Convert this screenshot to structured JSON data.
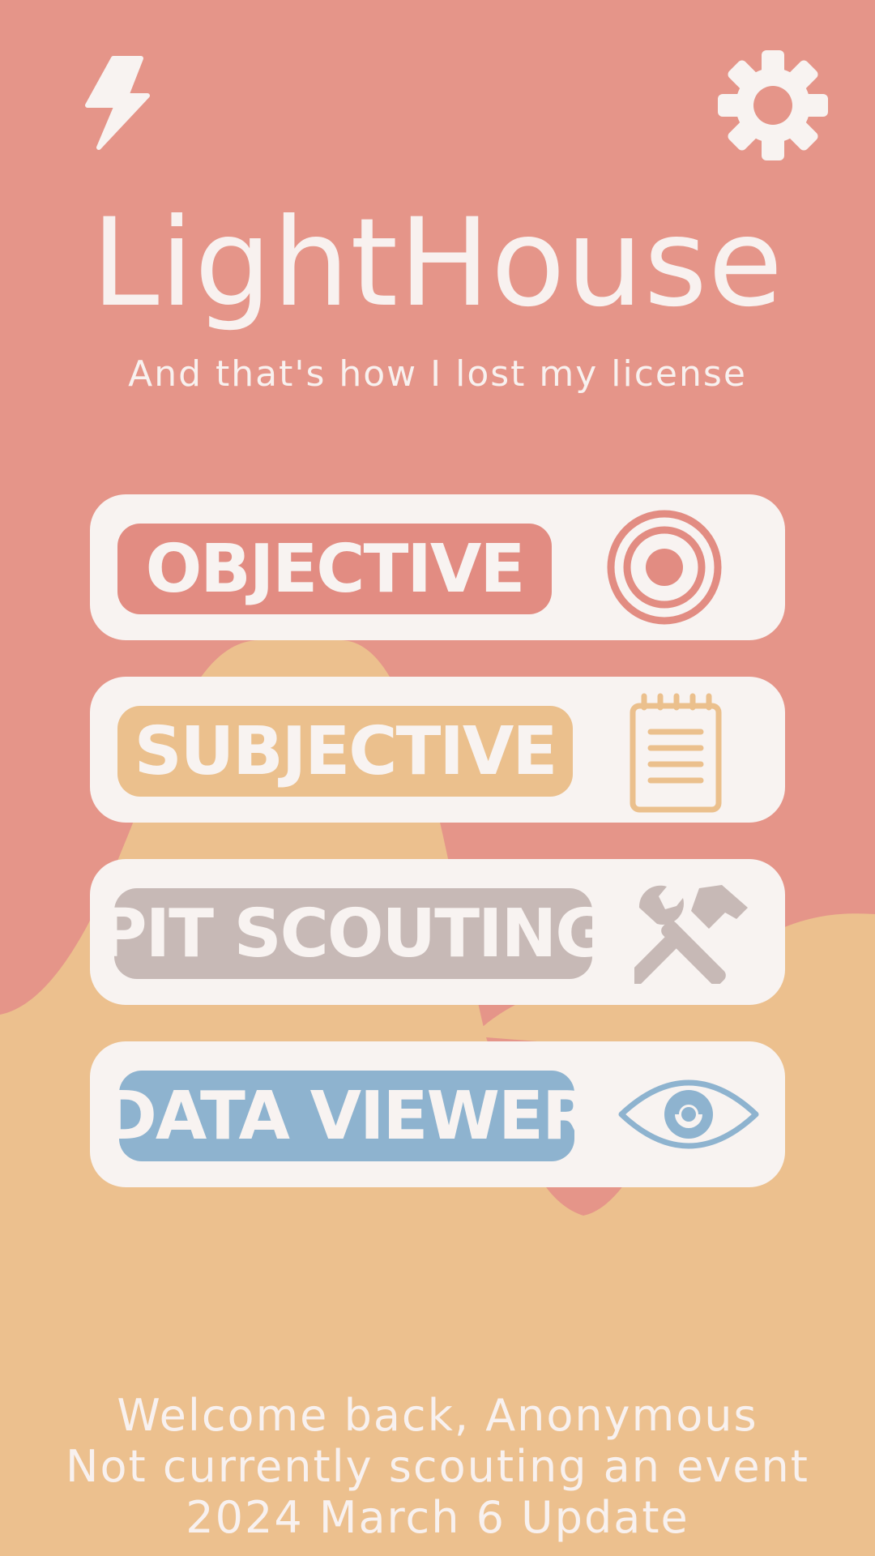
{
  "app": {
    "title": "LightHouse",
    "subtitle": "And that's how I lost my license"
  },
  "header": {
    "left_icon": "lightning-icon",
    "right_icon": "gear-icon"
  },
  "menu": [
    {
      "label": "OBJECTIVE",
      "icon": "target-icon",
      "color": "#E28C82"
    },
    {
      "label": "SUBJECTIVE",
      "icon": "notepad-icon",
      "color": "#EBC08D"
    },
    {
      "label": "PIT SCOUTING",
      "icon": "tools-icon",
      "color": "#C7B9B6"
    },
    {
      "label": "DATA VIEWER",
      "icon": "eye-icon",
      "color": "#8EB3CF"
    }
  ],
  "footer": {
    "welcome": "Welcome back, Anonymous",
    "event_status": "Not currently scouting an event",
    "version": "2024 March 6 Update"
  },
  "colors": {
    "background_primary": "#E59589",
    "background_secondary": "#ECC08E",
    "card": "#F8F3F1",
    "text_light": "#F8F1EF"
  }
}
